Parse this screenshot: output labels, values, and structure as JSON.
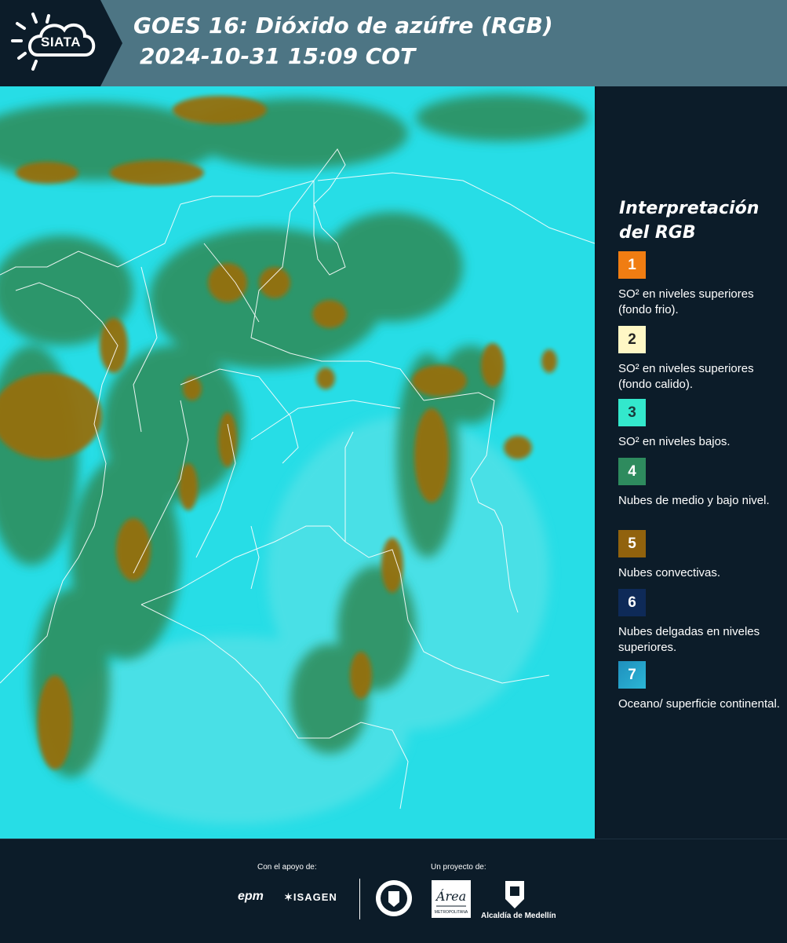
{
  "header": {
    "logo": "SIATA",
    "title_line1": "GOES 16: Dióxido de azúfre (RGB)",
    "title_line2": "2024-10-31 15:09 COT",
    "background_color": "#4d7584"
  },
  "legend": {
    "title": "Interpretación del RGB",
    "items": [
      {
        "number": "1",
        "color": "#f07d12",
        "text": "SO² en niveles superiores (fondo frio)."
      },
      {
        "number": "2",
        "color": "#fff7c5",
        "text": "SO² en niveles superiores (fondo calido)."
      },
      {
        "number": "3",
        "color": "#33e8cc",
        "text": "SO² en niveles bajos."
      },
      {
        "number": "4",
        "color": "#2e8b5e",
        "text": "Nubes de medio y bajo nivel."
      },
      {
        "number": "5",
        "color": "#91620d",
        "text": "Nubes convectivas."
      },
      {
        "number": "6",
        "color": "#0e2a58",
        "text": "Nubes delgadas en niveles superiores."
      },
      {
        "number": "7",
        "color": "#1f8fbd",
        "text": "Oceano/ superficie continental."
      }
    ]
  },
  "footer": {
    "support_caption": "Con el apoyo de:",
    "project_caption": "Un proyecto de:",
    "sponsors": [
      "epm",
      "ISAGEN"
    ],
    "partners": [
      "MEDELLÍN",
      "Área METROPOLITANA Valle de Aburrá",
      "Alcaldía de Medellín"
    ]
  },
  "map": {
    "ocean_color": "#27dde6",
    "convective_cloud_color": "#95700d",
    "mid_cloud_color": "#2e8a57"
  }
}
